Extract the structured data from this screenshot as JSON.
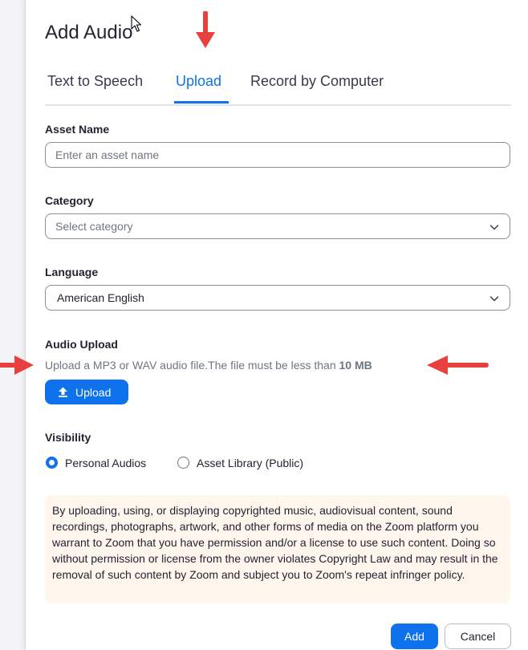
{
  "dialog": {
    "title": "Add Audio"
  },
  "tabs": [
    {
      "label": "Text to Speech",
      "active": false
    },
    {
      "label": "Upload",
      "active": true
    },
    {
      "label": "Record by Computer",
      "active": false
    }
  ],
  "asset_name": {
    "label": "Asset Name",
    "placeholder": "Enter an asset name",
    "value": ""
  },
  "category": {
    "label": "Category",
    "placeholder": "Select category"
  },
  "language": {
    "label": "Language",
    "value": "American English"
  },
  "audio_upload": {
    "label": "Audio Upload",
    "helper_text": "Upload a MP3 or WAV audio file.The file must be less than ",
    "size_limit": "10 MB",
    "button_label": "Upload",
    "button_icon": "upload-arrow-icon"
  },
  "visibility": {
    "label": "Visibility",
    "options": [
      {
        "label": "Personal Audios",
        "selected": true
      },
      {
        "label": "Asset Library (Public)",
        "selected": false
      }
    ]
  },
  "notice": {
    "text": "By uploading, using, or displaying copyrighted music, audiovisual content, sound recordings, photographs, artwork, and other forms of media on the Zoom platform you warrant to Zoom that you have permission and/or a license to use such content. Doing so without permission or license from the owner violates Copyright Law and may result in the removal of such content by Zoom and subject you to Zoom's repeat infringer policy."
  },
  "footer": {
    "add_label": "Add",
    "cancel_label": "Cancel"
  },
  "colors": {
    "accent": "#0e72ed",
    "annotation_arrow": "#e8403f",
    "notice_bg": "#fff7ee"
  }
}
